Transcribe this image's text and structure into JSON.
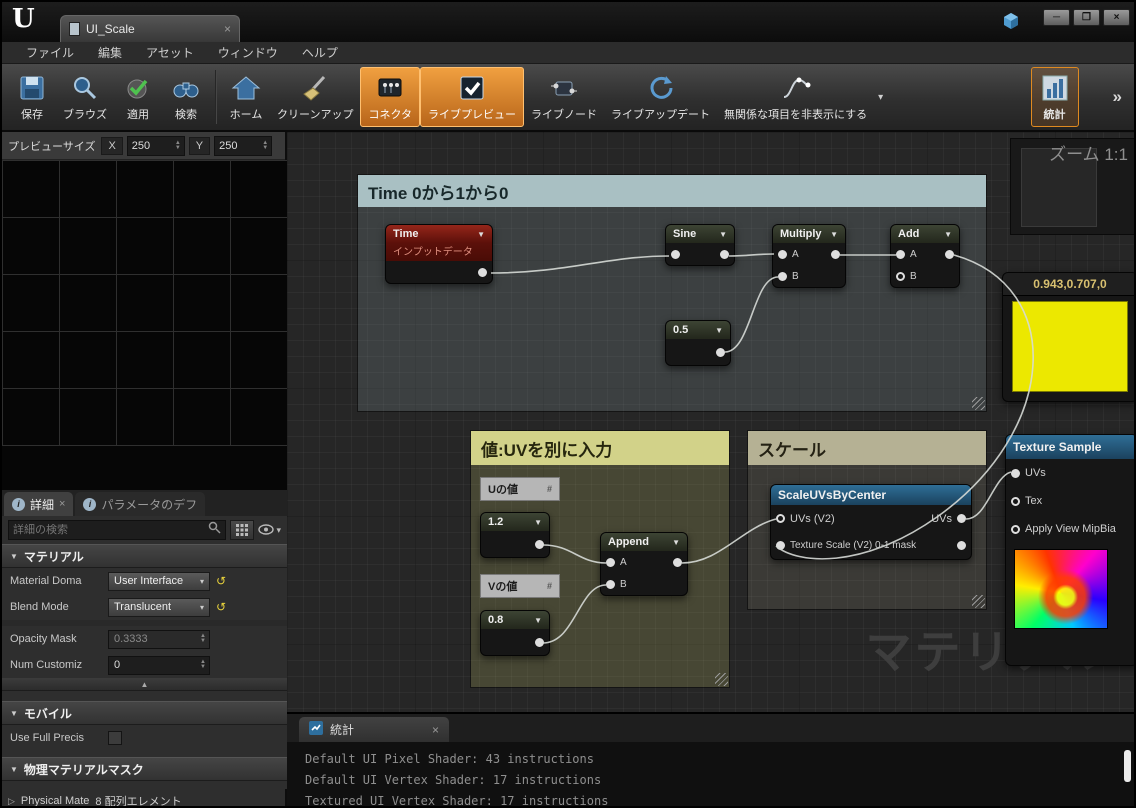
{
  "icons": {
    "close": "×",
    "caret": "▾",
    "triangle_down": "▼",
    "section_down": "▼",
    "collapse": "▲",
    "arrow_right": "▷",
    "info": "i",
    "reset": "↺",
    "spin_up": "▲",
    "spin_down": "▼",
    "minimize": "─",
    "maximize": "❒"
  },
  "titlebar": {
    "logo": "U",
    "tab": "UI_Scale"
  },
  "menu": {
    "items": [
      "ファイル",
      "編集",
      "アセット",
      "ウィンドウ",
      "ヘルプ"
    ]
  },
  "toolbar": {
    "buttons": [
      {
        "label": "保存"
      },
      {
        "label": "ブラウズ"
      },
      {
        "label": "適用"
      },
      {
        "label": "検索"
      },
      {
        "label": "ホーム"
      },
      {
        "label": "クリーンアップ"
      },
      {
        "label": "コネクタ"
      },
      {
        "label": "ライブプレビュー"
      },
      {
        "label": "ライブノード"
      },
      {
        "label": "ライブアップデート"
      },
      {
        "label": "無関係な項目を非表示にする"
      },
      {
        "label": "統計"
      }
    ],
    "overflow": "»"
  },
  "preview_panel": {
    "size_label": "プレビューサイズ",
    "x_label": "X",
    "x_value": "250",
    "y_label": "Y",
    "y_value": "250"
  },
  "details_panel": {
    "tab_details": "詳細",
    "tab_parameters": "パラメータのデフ",
    "search_placeholder": "詳細の検索",
    "section_material": "マテリアル",
    "rows": {
      "material_domain": {
        "label": "Material Doma",
        "value": "User Interface"
      },
      "blend_mode": {
        "label": "Blend Mode",
        "value": "Translucent"
      },
      "opacity_mask": {
        "label": "Opacity Mask",
        "value": "0.3333"
      },
      "num_customized": {
        "label": "Num Customiz",
        "value": "0"
      }
    },
    "section_mobile": "モバイル",
    "row_full_precision": "Use Full Precis",
    "section_physical": "物理マテリアルマスク",
    "row_physical": {
      "label": "Physical Mate",
      "value": "8 配列エレメント"
    }
  },
  "graph": {
    "zoom": "ズーム 1:1",
    "watermark": "マテリアル",
    "comments": {
      "time": "Time 0から1から0",
      "uv": "値:UVを別に入力",
      "scale": "スケール"
    },
    "nodes": {
      "time": {
        "title": "Time",
        "subtitle": "インプットデータ"
      },
      "sine": {
        "title": "Sine"
      },
      "multiply": {
        "title": "Multiply",
        "a": "A",
        "b": "B"
      },
      "add": {
        "title": "Add",
        "a": "A",
        "b": "B"
      },
      "half": {
        "title": "0.5"
      },
      "u_label": "Uの値",
      "const_u": {
        "title": "1.2"
      },
      "v_label": "Vの値",
      "const_v": {
        "title": "0.8"
      },
      "append": {
        "title": "Append",
        "a": "A",
        "b": "B"
      },
      "scaleuvs": {
        "title": "ScaleUVsByCenter",
        "in_uvs": "UVs (V2)",
        "in_scale": "Texture Scale (V2) 0-1 mask",
        "out_uvs": "UVs"
      },
      "vector": {
        "title": "0.943,0.707,0"
      },
      "texsample": {
        "title": "Texture Sample",
        "pin_uvs": "UVs",
        "pin_tex": "Tex",
        "pin_mip": "Apply View MipBia"
      }
    }
  },
  "stats": {
    "tab": "統計",
    "lines": [
      "Default UI Pixel Shader: 43 instructions",
      "Default UI Vertex Shader: 17 instructions",
      "Textured UI Vertex Shader: 17 instructions"
    ]
  }
}
